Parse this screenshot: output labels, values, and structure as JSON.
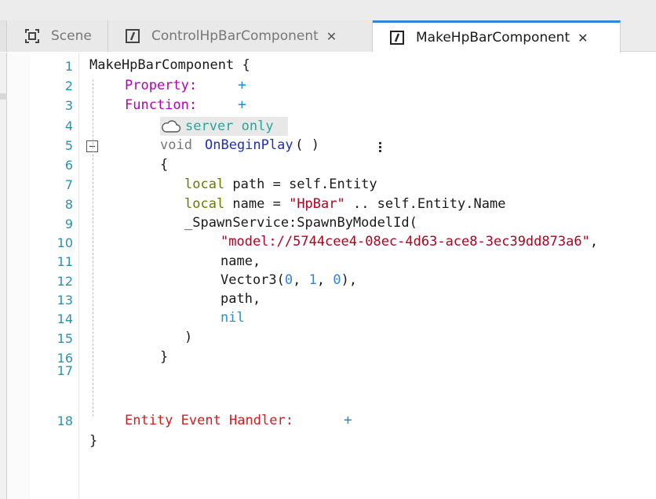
{
  "tabs": [
    {
      "label": "Scene",
      "icon": "scene-icon",
      "closable": false,
      "active": false
    },
    {
      "label": "ControlHpBarComponent",
      "icon": "script-icon",
      "closable": true,
      "active": false
    },
    {
      "label": "MakeHpBarComponent",
      "icon": "script-icon",
      "closable": true,
      "active": true
    }
  ],
  "close_glyph": "✕",
  "lines": [
    {
      "n": "1",
      "text": "MakeHpBarComponent {"
    },
    {
      "n": "2",
      "label": "Property:",
      "action": "+"
    },
    {
      "n": "3",
      "label": "Function:",
      "action": "+"
    },
    {
      "n": "4",
      "badge": "server only"
    },
    {
      "n": "5",
      "void": "void",
      "fn": "OnBeginPlay",
      "rest": " ( )"
    },
    {
      "n": "6",
      "text": "{"
    },
    {
      "n": "7",
      "kw": "local",
      "rest": " path = self.Entity"
    },
    {
      "n": "8",
      "kw": "local",
      "rest_a": " name = ",
      "str": "\"HpBar\"",
      "rest_b": " .. self.Entity.Name"
    },
    {
      "n": "9",
      "text": "_SpawnService:SpawnByModelId("
    },
    {
      "n": "10",
      "str": "\"model://5744cee4-08ec-4d63-ace8-3ec39dd873a6\"",
      "rest": ","
    },
    {
      "n": "11",
      "text": "name,"
    },
    {
      "n": "12",
      "pre": "Vector3(",
      "a": "0",
      "b": "1",
      "c": "0",
      "post": "),"
    },
    {
      "n": "13",
      "text": "path,"
    },
    {
      "n": "14",
      "nil": "nil"
    },
    {
      "n": "15",
      "text": ")"
    },
    {
      "n": "16",
      "text": "}"
    },
    {
      "n": "17",
      "text": ""
    },
    {
      "n": "18",
      "label": "Entity Event Handler:",
      "action": "+"
    },
    {
      "n": "",
      "text": "}"
    }
  ],
  "colors": {
    "accent": "#2f86d6",
    "line_numbers": "#2b91af",
    "keyword_local": "#6a7a00",
    "section_label": "#b400b4",
    "event_label": "#d11e1e",
    "string": "#b3001e",
    "badge_text": "#2aa59a"
  }
}
